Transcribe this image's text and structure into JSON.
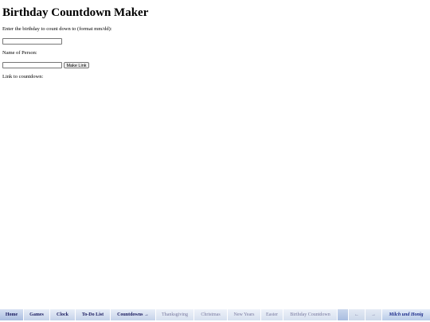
{
  "page": {
    "title": "Birthday Countdown Maker",
    "birthday_label": "Enter the birthday to count down to (format mm/dd):",
    "birthday_value": "",
    "name_label": "Name of Person:",
    "name_value": "",
    "make_link_button": "Make Link",
    "link_label": "Link to countdown:"
  },
  "navbar": {
    "items": [
      {
        "label": "Home"
      },
      {
        "label": "Games"
      },
      {
        "label": "Clock"
      },
      {
        "label": "To-Do List"
      },
      {
        "label": "Countdowns →"
      },
      {
        "label": "Thanksgiving"
      },
      {
        "label": "Christmas"
      },
      {
        "label": "New Years"
      },
      {
        "label": "Easter"
      },
      {
        "label": "Birthday Countdown"
      },
      {
        "label": ""
      },
      {
        "label": "←"
      },
      {
        "label": "→"
      },
      {
        "label": "Milch und Honig"
      }
    ]
  }
}
